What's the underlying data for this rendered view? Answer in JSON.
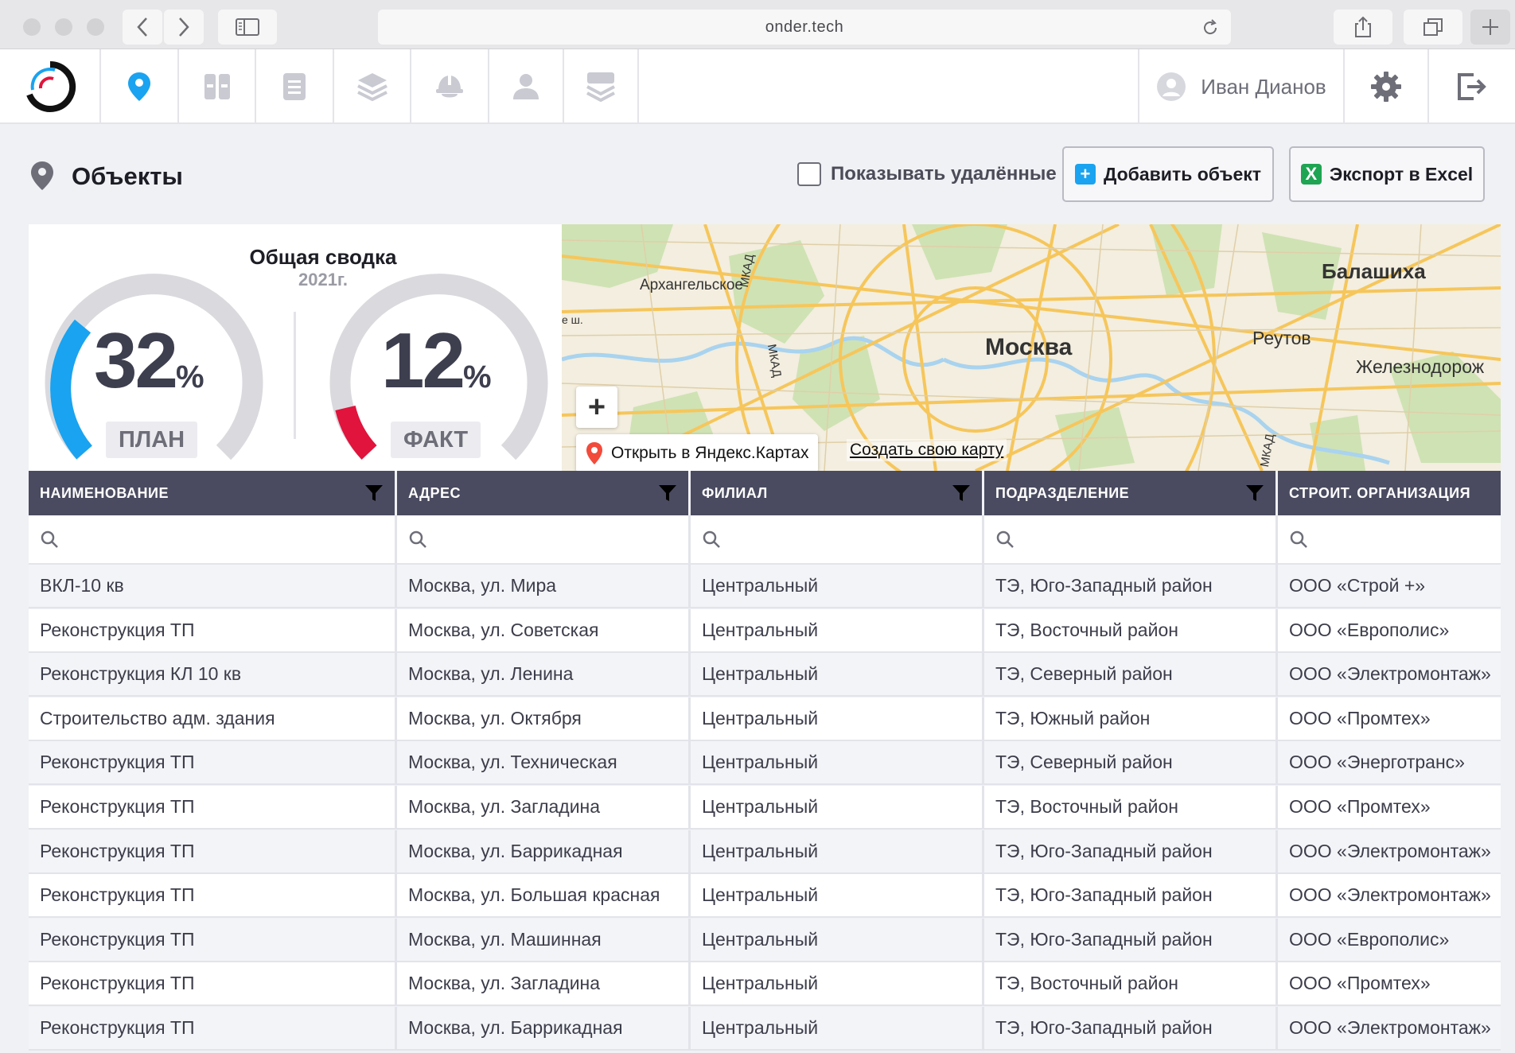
{
  "browser": {
    "url": "onder.tech"
  },
  "nav": {
    "items": [
      {
        "icon": "map-pin-icon"
      },
      {
        "icon": "dashboard-grid-icon"
      },
      {
        "icon": "document-list-icon"
      },
      {
        "icon": "layers-icon"
      },
      {
        "icon": "hard-hat-icon"
      },
      {
        "icon": "user-icon"
      },
      {
        "icon": "stack-icon"
      }
    ],
    "user_name": "Иван Дианов"
  },
  "page": {
    "title": "Объекты",
    "show_deleted_label": "Показывать удалённые",
    "add_button": "Добавить объект",
    "export_button": "Экспорт в Excel"
  },
  "summary": {
    "title": "Общая сводка",
    "year": "2021г.",
    "plan": {
      "value": "32",
      "unit": "%",
      "label": "ПЛАН",
      "color": "#1aa3f0"
    },
    "fact": {
      "value": "12",
      "unit": "%",
      "label": "ФАКТ",
      "color": "#e0143c"
    }
  },
  "map": {
    "labels": {
      "moscow": "Москва",
      "arkhangelskoe": "Архангельское",
      "balashikha": "Балашиха",
      "reutov": "Реутов",
      "zheleznodor": "Железнодорож",
      "mkad1": "МКАД",
      "mkad2": "МКАД",
      "mkad3": "МКАД",
      "esh": "е ш."
    },
    "open_yandex": "Открыть в Яндекс.Картах",
    "create_map": "Создать свою карту"
  },
  "table": {
    "columns": [
      "НАИМЕНОВАНИЕ",
      "АДРЕС",
      "ФИЛИАЛ",
      "ПОДРАЗДЕЛЕНИЕ",
      "СТРОИТ. ОРГАНИЗАЦИЯ"
    ],
    "rows": [
      [
        "ВКЛ-10 кв",
        "Москва, ул. Мира",
        "Центральный",
        "ТЭ, Юго-Западный район",
        "ООО «Строй +»"
      ],
      [
        "Реконструкция ТП",
        "Москва, ул. Советская",
        "Центральный",
        "ТЭ, Восточный район",
        "ООО «Европолис»"
      ],
      [
        "Реконструкция КЛ 10 кв",
        "Москва, ул. Ленина",
        "Центральный",
        "ТЭ, Северный район",
        "ООО «Электромонтаж»"
      ],
      [
        "Строительство адм. здания",
        "Москва, ул. Октября",
        "Центральный",
        "ТЭ, Южный район",
        "ООО «Промтех»"
      ],
      [
        "Реконструкция ТП",
        "Москва, ул. Техническая",
        "Центральный",
        "ТЭ, Северный район",
        "ООО «Энерготранс»"
      ],
      [
        "Реконструкция ТП",
        "Москва, ул. Загладина",
        "Центральный",
        "ТЭ, Восточный район",
        "ООО «Промтех»"
      ],
      [
        "Реконструкция ТП",
        "Москва, ул. Баррикадная",
        "Центральный",
        "ТЭ, Юго-Западный район",
        "ООО «Электромонтаж»"
      ],
      [
        "Реконструкция ТП",
        "Москва, ул. Большая красная",
        "Центральный",
        "ТЭ, Юго-Западный район",
        "ООО «Электромонтаж»"
      ],
      [
        "Реконструкция ТП",
        "Москва, ул. Машинная",
        "Центральный",
        "ТЭ, Юго-Западный район",
        "ООО «Европолис»"
      ],
      [
        "Реконструкция ТП",
        "Москва, ул. Загладина",
        "Центральный",
        "ТЭ, Восточный район",
        "ООО «Промтех»"
      ],
      [
        "Реконструкция ТП",
        "Москва, ул. Баррикадная",
        "Центральный",
        "ТЭ, Юго-Западный район",
        "ООО «Электромонтаж»"
      ]
    ]
  }
}
